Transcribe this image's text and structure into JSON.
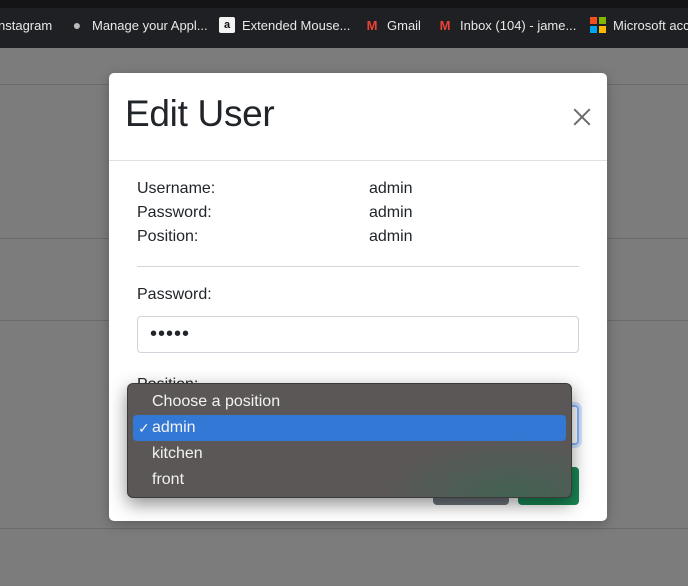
{
  "bookmarks": [
    {
      "label": "nstagram",
      "icon": "none"
    },
    {
      "label": "Manage your Appl...",
      "icon": "apple-icon"
    },
    {
      "label": "Extended Mouse...",
      "icon": "amazon-icon"
    },
    {
      "label": "Gmail",
      "icon": "gmail-icon"
    },
    {
      "label": "Inbox (104) - jame...",
      "icon": "gmail-icon"
    },
    {
      "label": "Microsoft acc",
      "icon": "microsoft-icon"
    }
  ],
  "icons": {
    "amazon": "a",
    "gmail": "M",
    "apple": ""
  },
  "modal": {
    "title": "Edit User",
    "info": [
      {
        "label": "Username:",
        "value": "admin"
      },
      {
        "label": "Password:",
        "value": "admin"
      },
      {
        "label": "Position:",
        "value": "admin"
      }
    ],
    "password_label": "Password:",
    "password_value": "admin",
    "position_label": "Position:"
  },
  "dropdown": {
    "options": [
      {
        "label": "Choose a position",
        "selected": false
      },
      {
        "label": "admin",
        "selected": true,
        "check": "✓"
      },
      {
        "label": "kitchen",
        "selected": false
      },
      {
        "label": "front",
        "selected": false
      }
    ]
  },
  "colors": {
    "selected_option": "#3478d6",
    "save_button": "#198754",
    "close_button": "#6c757d",
    "dropdown_bg": "#5b5756"
  }
}
